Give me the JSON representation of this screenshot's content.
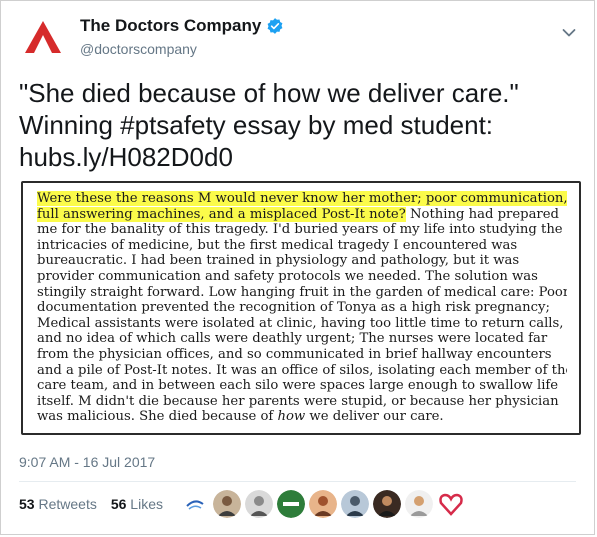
{
  "account": {
    "name": "The Doctors Company",
    "handle": "@doctorscompany"
  },
  "tweet": {
    "line1": "\"She died because of how we deliver care.\"",
    "line2": "Winning #ptsafety essay by med student:",
    "link": "hubs.ly/H082D0d0"
  },
  "essay": {
    "highlighted_1": "Were these the reasons M would never know her mother; poor communication,",
    "highlighted_2": "full answering machines, and a misplaced Post-It note?",
    "line2_rest": " Nothing had prepared",
    "lines": [
      "me for the banality of this tragedy. I'd buried years of my life into studying the",
      "intricacies of medicine, but the first medical tragedy I encountered was",
      "bureaucratic. I had been trained in physiology and pathology, but it was",
      "provider communication and safety protocols we needed. The solution was",
      "stingily straight forward. Low hanging fruit in the garden of medical care: Poor",
      "documentation prevented the recognition of Tonya as a high risk pregnancy;",
      "Medical assistants were isolated at clinic, having too little time to return calls,",
      "and no idea of which calls were deathly urgent; The nurses were located far",
      "from the physician offices, and so communicated in brief hallway encounters",
      "and a pile of Post-It notes. It was an office of silos, isolating each member of the",
      "care team, and in between each silo were spaces large enough to swallow life",
      "itself. M didn't die because her parents were stupid, or because her physician",
      "was malicious. She died because of "
    ],
    "last_italic": "how",
    "last_rest": " we deliver our care."
  },
  "meta": {
    "timestamp": "9:07 AM - 16 Jul 2017",
    "retweets_count": "53",
    "retweets_label": "Retweets",
    "likes_count": "56",
    "likes_label": "Likes"
  },
  "colors": {
    "brand_red": "#d62b2b",
    "verified_blue": "#1da1f2",
    "highlight": "#fbfb4a"
  }
}
